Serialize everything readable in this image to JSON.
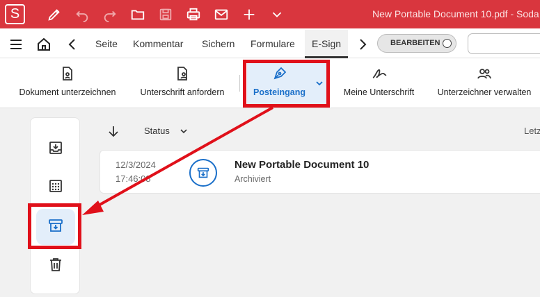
{
  "titlebar": {
    "app_logo": "S",
    "document_title": "New Portable Document 10.pdf - Soda"
  },
  "tabs": [
    {
      "label": "Seite"
    },
    {
      "label": "Kommentar"
    },
    {
      "label": "Sichern"
    },
    {
      "label": "Formulare"
    },
    {
      "label": "E-Sign"
    }
  ],
  "edit_toggle_label": "BEARBEITEN",
  "ribbon": {
    "sign_document": "Dokument unterzeichnen",
    "request_signature": "Unterschrift anfordern",
    "inbox": "Posteingang",
    "my_signature": "Meine Unterschrift",
    "manage_signers": "Unterzeichner verwalten"
  },
  "list": {
    "sort_label": "Status",
    "column_right": "Letzte",
    "rows": [
      {
        "date": "12/3/2024",
        "time": "17:46:08",
        "title": "New Portable Document 10",
        "status": "Archiviert"
      }
    ]
  },
  "colors": {
    "brand_red": "#d9363e",
    "accent_blue": "#1a6fc9",
    "annotation_red": "#e0101a"
  }
}
